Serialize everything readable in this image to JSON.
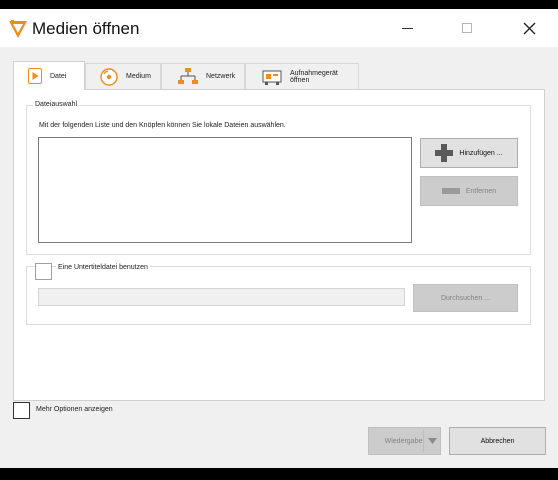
{
  "window": {
    "title": "Medien öffnen"
  },
  "tabs": [
    {
      "label": "Datei",
      "icon": "file-play-icon",
      "active": true
    },
    {
      "label": "Medium",
      "icon": "disc-icon",
      "active": false
    },
    {
      "label": "Netzwerk",
      "icon": "network-icon",
      "active": false
    },
    {
      "label": "Aufnahmegerät öffnen",
      "icon": "capture-card-icon",
      "active": false
    }
  ],
  "file_selection": {
    "legend": "Dateiauswahl",
    "description": "Mit der folgenden Liste und den Knöpfen können Sie lokale Dateien auswählen.",
    "add_label": "Hinzufügen ...",
    "remove_label": "Entfernen"
  },
  "subtitle": {
    "checkbox_label": "Eine Untertiteldatei benutzen",
    "browse_label": "Durchsuchen ..."
  },
  "footer": {
    "more_options_label": "Mehr Optionen anzeigen",
    "play_label": "Wiedergabe",
    "cancel_label": "Abbrechen"
  },
  "colors": {
    "accent_orange": "#f08c1a",
    "window_bg": "#f0f0f0",
    "disabled_button": "#cccccc"
  }
}
